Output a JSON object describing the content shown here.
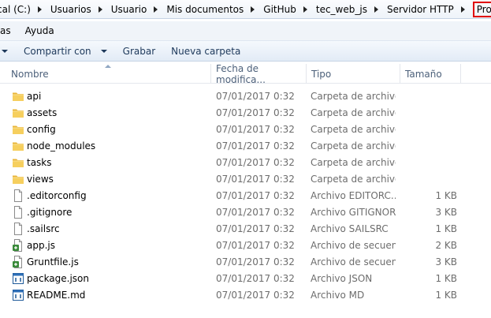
{
  "breadcrumb": {
    "items": [
      "cal (C:)",
      "Usuarios",
      "Usuario",
      "Mis documentos",
      "GitHub",
      "tec_web_js",
      "Servidor HTTP"
    ],
    "current": "Proyecto"
  },
  "menubar": {
    "items": [
      "as",
      "Ayuda"
    ]
  },
  "toolbar": {
    "share_label": "Compartir con",
    "burn_label": "Grabar",
    "new_folder_label": "Nueva carpeta"
  },
  "columns": {
    "name": "Nombre",
    "date": "Fecha de modifica...",
    "type": "Tipo",
    "size": "Tamaño"
  },
  "files": [
    {
      "name": "api",
      "date": "07/01/2017 0:32",
      "type": "Carpeta de archivos",
      "size": "",
      "icon": "folder-icon"
    },
    {
      "name": "assets",
      "date": "07/01/2017 0:32",
      "type": "Carpeta de archivos",
      "size": "",
      "icon": "folder-icon"
    },
    {
      "name": "config",
      "date": "07/01/2017 0:32",
      "type": "Carpeta de archivos",
      "size": "",
      "icon": "folder-icon"
    },
    {
      "name": "node_modules",
      "date": "07/01/2017 0:32",
      "type": "Carpeta de archivos",
      "size": "",
      "icon": "folder-icon"
    },
    {
      "name": "tasks",
      "date": "07/01/2017 0:32",
      "type": "Carpeta de archivos",
      "size": "",
      "icon": "folder-icon"
    },
    {
      "name": "views",
      "date": "07/01/2017 0:32",
      "type": "Carpeta de archivos",
      "size": "",
      "icon": "folder-icon"
    },
    {
      "name": ".editorconfig",
      "date": "07/01/2017 0:32",
      "type": "Archivo EDITORC...",
      "size": "1 KB",
      "icon": "file-icon"
    },
    {
      "name": ".gitignore",
      "date": "07/01/2017 0:32",
      "type": "Archivo GITIGNORE",
      "size": "3 KB",
      "icon": "file-icon"
    },
    {
      "name": ".sailsrc",
      "date": "07/01/2017 0:32",
      "type": "Archivo SAILSRC",
      "size": "1 KB",
      "icon": "file-icon"
    },
    {
      "name": "app.js",
      "date": "07/01/2017 0:32",
      "type": "Archivo de secuen...",
      "size": "2 KB",
      "icon": "script-file-icon"
    },
    {
      "name": "Gruntfile.js",
      "date": "07/01/2017 0:32",
      "type": "Archivo de secuen...",
      "size": "3 KB",
      "icon": "script-file-icon"
    },
    {
      "name": "package.json",
      "date": "07/01/2017 0:32",
      "type": "Archivo JSON",
      "size": "1 KB",
      "icon": "json-file-icon"
    },
    {
      "name": "README.md",
      "date": "07/01/2017 0:32",
      "type": "Archivo MD",
      "size": "1 KB",
      "icon": "json-file-icon"
    }
  ],
  "colors": {
    "highlight_border": "#e00000",
    "folder": "#f3c64f",
    "header_text": "#4c607a",
    "toolbar_text": "#1e395b"
  }
}
